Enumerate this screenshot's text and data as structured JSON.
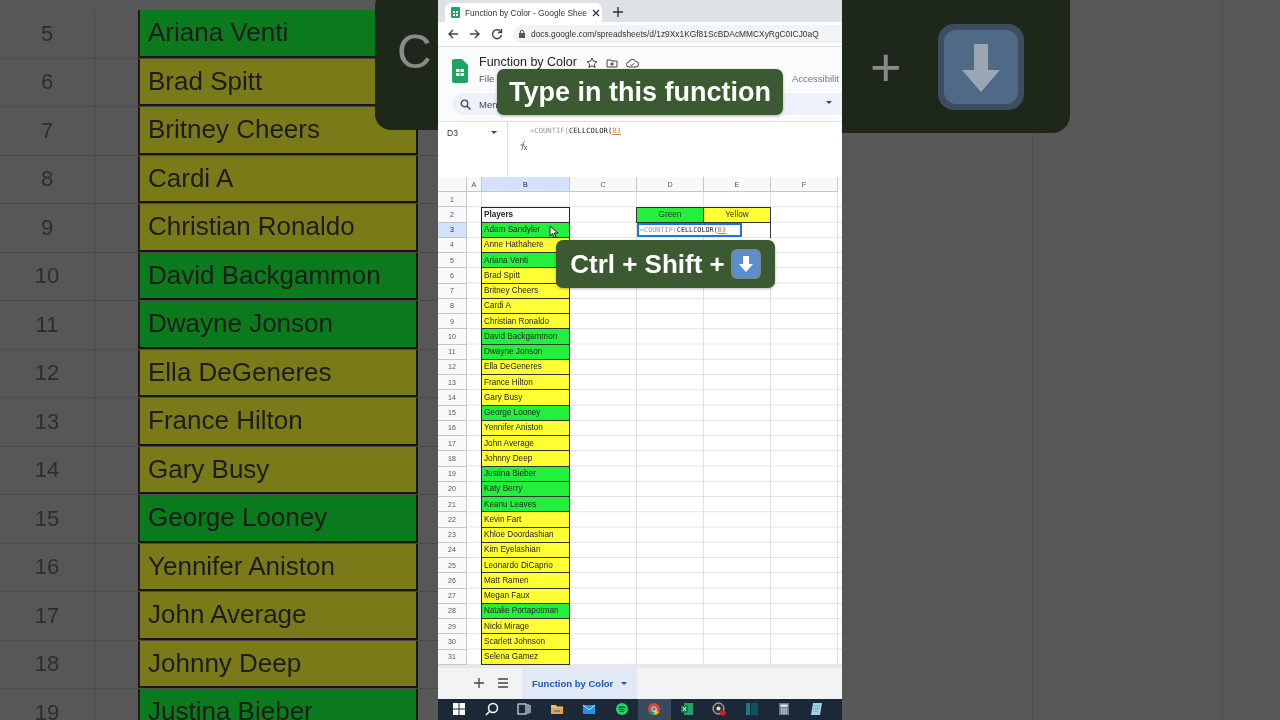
{
  "backdrop_left": {
    "overlay_letter": "C",
    "rows": [
      {
        "label": "5",
        "name": "Ariana Venti",
        "color": "#0b7a1c"
      },
      {
        "label": "6",
        "name": "Brad Spitt",
        "color": "#7a7a18"
      },
      {
        "label": "7",
        "name": "Britney Cheers",
        "color": "#7a7a18"
      },
      {
        "label": "8",
        "name": "Cardi A",
        "color": "#7a7a18"
      },
      {
        "label": "9",
        "name": "Christian Ronaldo",
        "color": "#7a7a18"
      },
      {
        "label": "10",
        "name": "David Backgammon",
        "color": "#0b7a1c"
      },
      {
        "label": "11",
        "name": "Dwayne Jonson",
        "color": "#0b7a1c"
      },
      {
        "label": "12",
        "name": "Ella DeGeneres",
        "color": "#7a7a18"
      },
      {
        "label": "13",
        "name": "France Hilton",
        "color": "#7a7a18"
      },
      {
        "label": "14",
        "name": "Gary Busy",
        "color": "#7a7a18"
      },
      {
        "label": "15",
        "name": "George Looney",
        "color": "#0b7a1c"
      },
      {
        "label": "16",
        "name": "Yennifer Aniston",
        "color": "#7a7a18"
      },
      {
        "label": "17",
        "name": "John Average",
        "color": "#7a7a18"
      },
      {
        "label": "18",
        "name": "Johnny Deep",
        "color": "#7a7a18"
      },
      {
        "label": "19",
        "name": "Justina Bieber",
        "color": "#0b7a1c"
      }
    ]
  },
  "backdrop_right": {
    "overlay_text": "+"
  },
  "browser": {
    "tab_title": "Function by Color - Google Shee",
    "url": "docs.google.com/spreadsheets/d/1z9Xx1KGf81ScBDAcMMCXyRgC0ICJ0aQ"
  },
  "document": {
    "title": "Function by Color",
    "menu": [
      "File",
      "Accessibilit"
    ],
    "search_placeholder": "Men"
  },
  "formula_bar": {
    "cell_ref": "D3",
    "parts": [
      {
        "text": "=COUNTIF(",
        "kind": "function"
      },
      {
        "text": "CELLCOLOR(",
        "kind": "custom"
      },
      {
        "text": "B3",
        "kind": "reference"
      }
    ]
  },
  "grid": {
    "columns": [
      {
        "label": "A",
        "selected": false
      },
      {
        "label": "B",
        "selected": true
      },
      {
        "label": "C",
        "selected": false
      },
      {
        "label": "D",
        "selected": false
      },
      {
        "label": "E",
        "selected": false
      },
      {
        "label": "F",
        "selected": false
      }
    ],
    "rows": [
      {
        "label": "1",
        "selected": false
      },
      {
        "label": "2",
        "selected": false
      },
      {
        "label": "3",
        "selected": true
      },
      {
        "label": "4",
        "selected": false
      },
      {
        "label": "5",
        "selected": false
      },
      {
        "label": "6",
        "selected": false
      },
      {
        "label": "7",
        "selected": false
      },
      {
        "label": "8",
        "selected": false
      },
      {
        "label": "9",
        "selected": false
      },
      {
        "label": "10",
        "selected": false
      },
      {
        "label": "11",
        "selected": false
      },
      {
        "label": "12",
        "selected": false
      },
      {
        "label": "13",
        "selected": false
      },
      {
        "label": "14",
        "selected": false
      },
      {
        "label": "15",
        "selected": false
      },
      {
        "label": "16",
        "selected": false
      },
      {
        "label": "17",
        "selected": false
      },
      {
        "label": "18",
        "selected": false
      },
      {
        "label": "19",
        "selected": false
      },
      {
        "label": "20",
        "selected": false
      },
      {
        "label": "21",
        "selected": false
      },
      {
        "label": "22",
        "selected": false
      },
      {
        "label": "23",
        "selected": false
      },
      {
        "label": "24",
        "selected": false
      },
      {
        "label": "25",
        "selected": false
      },
      {
        "label": "26",
        "selected": false
      },
      {
        "label": "27",
        "selected": false
      },
      {
        "label": "28",
        "selected": false
      },
      {
        "label": "29",
        "selected": false
      },
      {
        "label": "30",
        "selected": false
      },
      {
        "label": "31",
        "selected": false
      }
    ]
  },
  "players": {
    "header": "Players",
    "items": [
      {
        "name": "Adam Sandyler",
        "color": "#22f03c"
      },
      {
        "name": "Anne Hathahere",
        "color": "#ffff33"
      },
      {
        "name": "Ariana Venti",
        "color": "#22f03c"
      },
      {
        "name": "Brad Spitt",
        "color": "#ffff33"
      },
      {
        "name": "Britney Cheers",
        "color": "#ffff33"
      },
      {
        "name": "Cardi A",
        "color": "#ffff33"
      },
      {
        "name": "Christian Ronaldo",
        "color": "#ffff33"
      },
      {
        "name": "David Backgammon",
        "color": "#22f03c"
      },
      {
        "name": "Dwayne Jonson",
        "color": "#22f03c"
      },
      {
        "name": "Ella DeGeneres",
        "color": "#ffff33"
      },
      {
        "name": "France Hilton",
        "color": "#ffff33"
      },
      {
        "name": "Gary Busy",
        "color": "#ffff33"
      },
      {
        "name": "George Looney",
        "color": "#22f03c"
      },
      {
        "name": "Yennifer Aniston",
        "color": "#ffff33"
      },
      {
        "name": "John Average",
        "color": "#ffff33"
      },
      {
        "name": "Johnny Deep",
        "color": "#ffff33"
      },
      {
        "name": "Justina Bieber",
        "color": "#22f03c"
      },
      {
        "name": "Katy Berry",
        "color": "#22f03c"
      },
      {
        "name": "Keanu Leaves",
        "color": "#22f03c"
      },
      {
        "name": "Kevin Fart",
        "color": "#ffff33"
      },
      {
        "name": "Khloe Doordashian",
        "color": "#ffff33"
      },
      {
        "name": "Kim Eyelashian",
        "color": "#ffff33"
      },
      {
        "name": "Leonardo DiCaprio",
        "color": "#ffff33"
      },
      {
        "name": "Matt Ramen",
        "color": "#ffff33"
      },
      {
        "name": "Megan Faux",
        "color": "#ffff33"
      },
      {
        "name": "Natalie Portapotman",
        "color": "#22f03c"
      },
      {
        "name": "Nicki Mirage",
        "color": "#ffff33"
      },
      {
        "name": "Scarlett Johnson",
        "color": "#ffff33"
      },
      {
        "name": "Selena Gamez",
        "color": "#ffff33"
      }
    ]
  },
  "summary": {
    "headers": [
      {
        "label": "Green",
        "color": "#22f03c"
      },
      {
        "label": "Yellow",
        "color": "#ffff33"
      }
    ],
    "editor_parts": [
      {
        "text": "=COUNTIF(",
        "kind": "function"
      },
      {
        "text": "CELLCOLOR(",
        "kind": "custom"
      },
      {
        "text": "B3",
        "kind": "reference"
      }
    ]
  },
  "sheet_tabs": [
    {
      "label": "Function by Color",
      "selected": true
    }
  ],
  "taskbar": [
    {
      "kind": "start",
      "active": false
    },
    {
      "kind": "search",
      "active": false
    },
    {
      "kind": "taskview",
      "active": false
    },
    {
      "kind": "explorer",
      "active": false
    },
    {
      "kind": "mail",
      "active": false
    },
    {
      "kind": "music",
      "active": false
    },
    {
      "kind": "browser",
      "active": true
    },
    {
      "kind": "excel",
      "active": false
    },
    {
      "kind": "recorder",
      "active": false
    },
    {
      "kind": "panel",
      "active": false
    },
    {
      "kind": "calculator",
      "active": false
    },
    {
      "kind": "notes",
      "active": false
    }
  ],
  "captions": [
    {
      "text": "Type in this function"
    },
    {
      "text": "Ctrl + Shift +"
    }
  ]
}
